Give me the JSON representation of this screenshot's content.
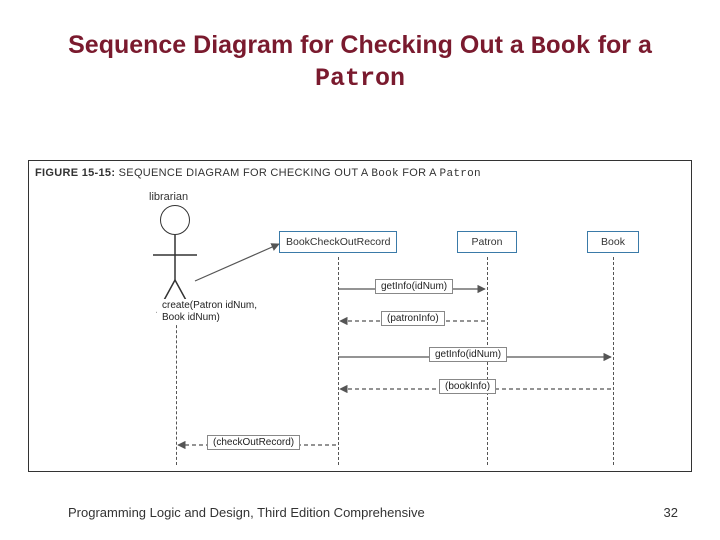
{
  "title": {
    "part1": "Sequence Diagram for Checking Out a ",
    "book": "Book",
    "mid": " for a ",
    "patron": "Patron"
  },
  "figure": {
    "label_bold": "FIGURE 15-15:",
    "label_plain1": " SEQUENCE DIAGRAM FOR CHECKING OUT A ",
    "label_mono1": "Book",
    "label_plain2": " FOR A ",
    "label_mono2": "Patron"
  },
  "actor": {
    "label": "librarian"
  },
  "objects": {
    "bcr": "BookCheckOutRecord",
    "patron": "Patron",
    "book": "Book"
  },
  "messages": {
    "create": "create(Patron idNum,\nBook idNum)",
    "getInfoPatron": "getInfo(idNum)",
    "patronInfo": "(patronInfo)",
    "getInfoBook": "getInfo(idNum)",
    "bookInfo": "(bookInfo)",
    "checkoutRecord": "(checkOutRecord)"
  },
  "footer": {
    "text": "Programming Logic and Design, Third Edition Comprehensive",
    "page": "32"
  }
}
